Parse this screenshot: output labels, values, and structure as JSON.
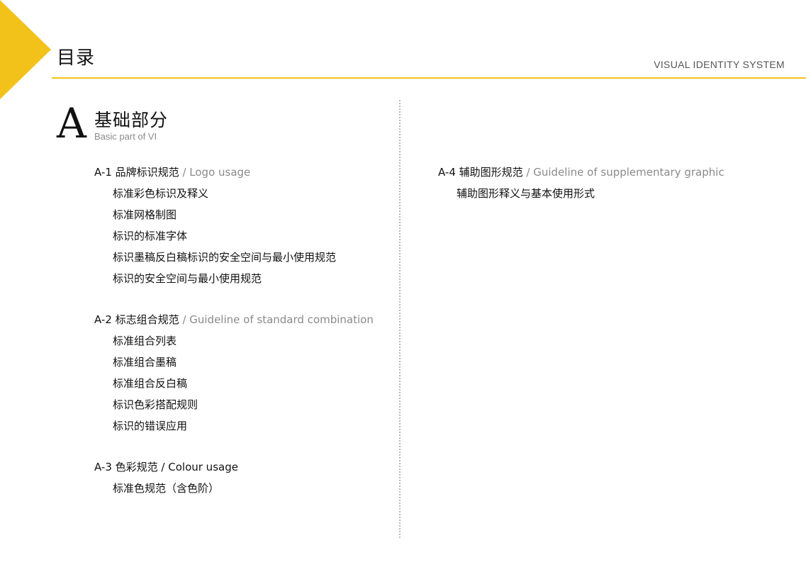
{
  "colors": {
    "accent": "#f2c21b",
    "text": "#111111",
    "muted": "#8a8a8a",
    "divider": "#b9b9b9"
  },
  "header": {
    "title": "目录",
    "system_label": "VISUAL IDENTITY SYSTEM"
  },
  "section": {
    "letter": "A",
    "title": "基础部分",
    "subtitle": "Basic part of VI"
  },
  "groups": [
    {
      "code": "A-1 品牌标识规范",
      "english": " / Logo usage",
      "items": [
        "标准彩色标识及释义",
        "标准网格制图",
        "标识的标准字体",
        "标识墨稿反白稿标识的安全空间与最小使用规范",
        "标识的安全空间与最小使用规范"
      ]
    },
    {
      "code": "A-2 标志组合规范",
      "english": " / Guideline of standard combination",
      "items": [
        "标准组合列表",
        "标准组合墨稿",
        "标准组合反白稿",
        "标识色彩搭配规则",
        "标识的错误应用"
      ]
    },
    {
      "code": "A-3 色彩规范",
      "english": " / Colour usage",
      "items": [
        "标准色规范（含色阶）"
      ]
    },
    {
      "code": "A-4 辅助图形规范",
      "english": " / Guideline of supplementary graphic",
      "items": [
        "辅助图形释义与基本使用形式"
      ]
    }
  ]
}
